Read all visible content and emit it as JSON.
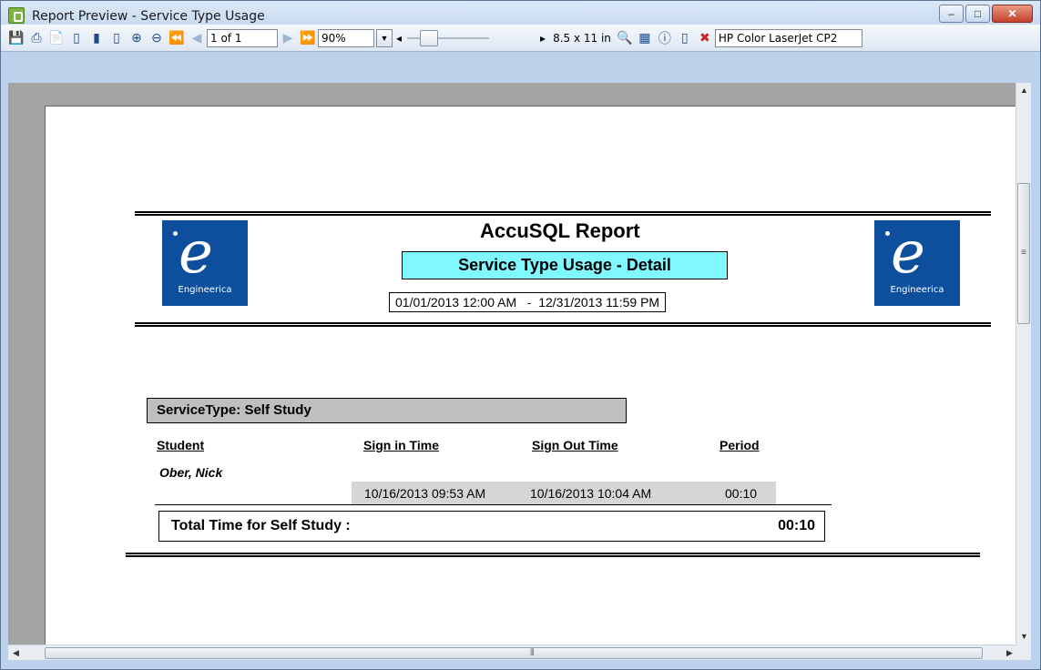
{
  "window": {
    "title": "Report Preview - Service Type Usage"
  },
  "toolbar": {
    "page_indicator": "1 of 1",
    "zoom": "90%",
    "paper_size": "8.5 x 11 in",
    "printer": "HP Color LaserJet CP2"
  },
  "report": {
    "title": "AccuSQL Report",
    "subtitle": "Service Type Usage - Detail",
    "date_range": "01/01/2013 12:00 AM   -  12/31/2013 11:59 PM",
    "logo_caption": "Engineerica",
    "service_type_label": "ServiceType:",
    "service_type_value": "Self Study",
    "columns": [
      "Student",
      "Sign in Time",
      "Sign Out Time",
      "Period"
    ],
    "student_name": "Ober, Nick",
    "row": {
      "sign_in": "10/16/2013 09:53 AM",
      "sign_out": "10/16/2013 10:04 AM",
      "period": "00:10"
    },
    "total_label": "Total Time for Self Study :",
    "total_value": "00:10"
  },
  "colors": {
    "subtitle_bg": "#7ff9ff",
    "logo_bg": "#0d4f9c",
    "section_bg": "#bfbfbf",
    "row_bg": "#d6d6d6"
  },
  "icons": [
    "save-icon",
    "print-icon",
    "print-setup-icon",
    "single-page-icon",
    "two-page-icon",
    "four-page-icon",
    "zoom-in-icon",
    "zoom-out-icon",
    "first-page-icon",
    "prev-page-icon",
    "next-page-icon",
    "last-page-icon",
    "find-icon",
    "thumbnails-icon",
    "help-icon",
    "new-icon",
    "export-pdf-icon"
  ]
}
